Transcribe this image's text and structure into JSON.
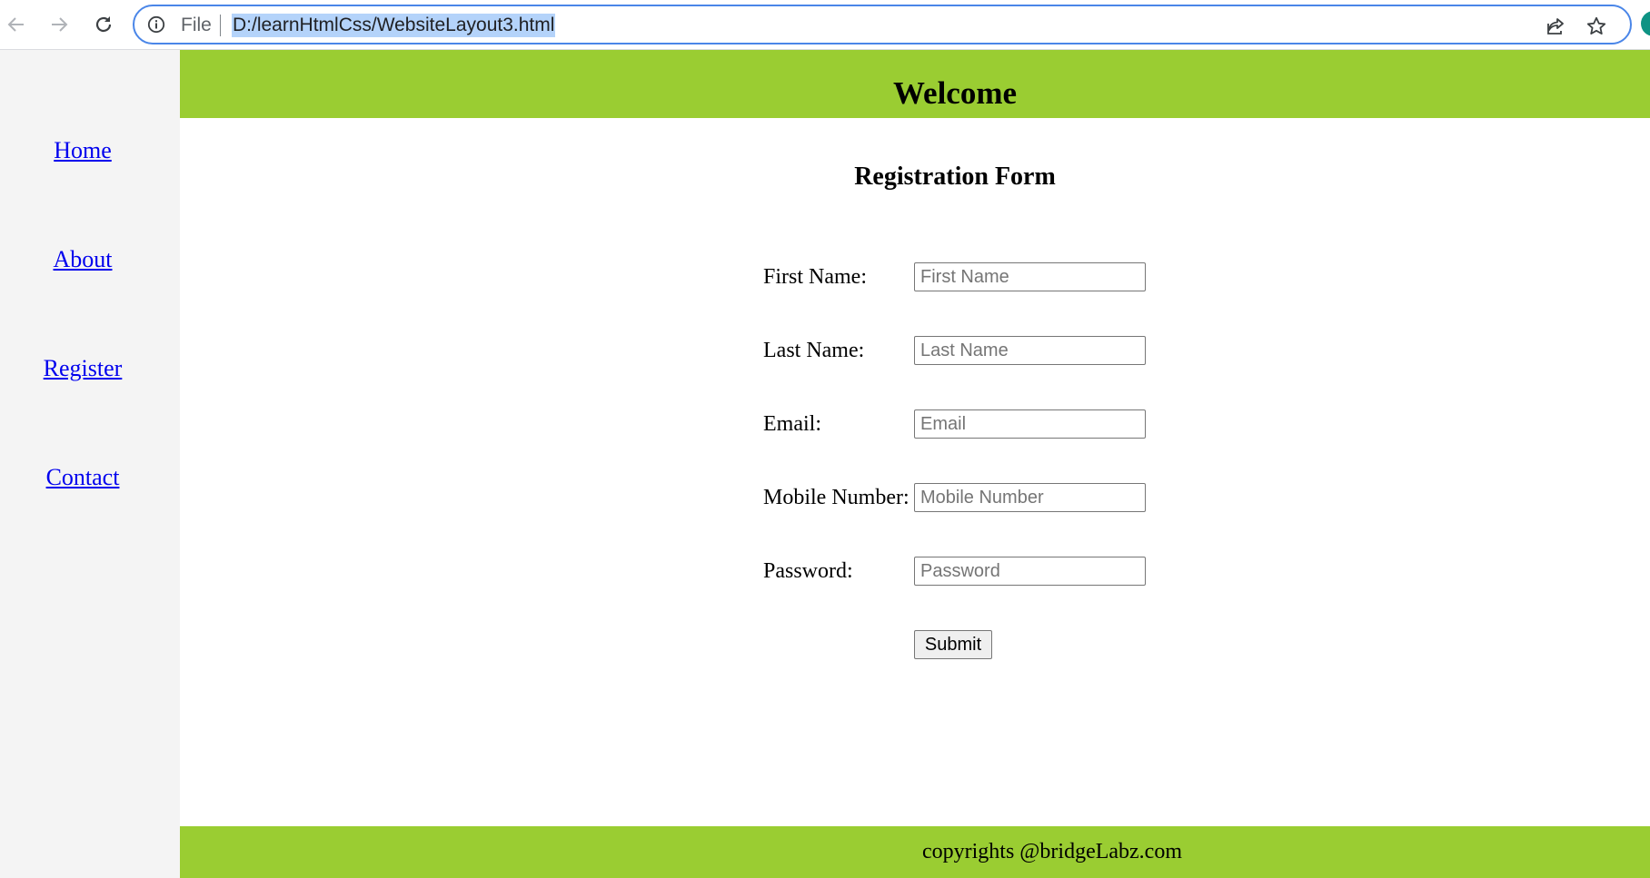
{
  "browser": {
    "scheme_label": "File",
    "url": "D:/learnHtmlCss/WebsiteLayout3.html"
  },
  "sidebar": {
    "links": [
      {
        "label": "Home"
      },
      {
        "label": "About"
      },
      {
        "label": "Register"
      },
      {
        "label": "Contact"
      }
    ]
  },
  "header": {
    "title": "Welcome"
  },
  "form": {
    "title": "Registration Form",
    "fields": [
      {
        "label": "First Name:",
        "placeholder": "First Name"
      },
      {
        "label": "Last Name:",
        "placeholder": "Last Name"
      },
      {
        "label": "Email:",
        "placeholder": "Email"
      },
      {
        "label": "Mobile Number:",
        "placeholder": "Mobile Number"
      },
      {
        "label": "Password:",
        "placeholder": "Password"
      }
    ],
    "submit_label": "Submit"
  },
  "footer": {
    "text": "copyrights @bridgeLabz.com"
  },
  "colors": {
    "banner": "#9acd32",
    "sidebar_bg": "#f4f4f4",
    "link": "#0000ee",
    "address_focus": "#4a86e8"
  }
}
